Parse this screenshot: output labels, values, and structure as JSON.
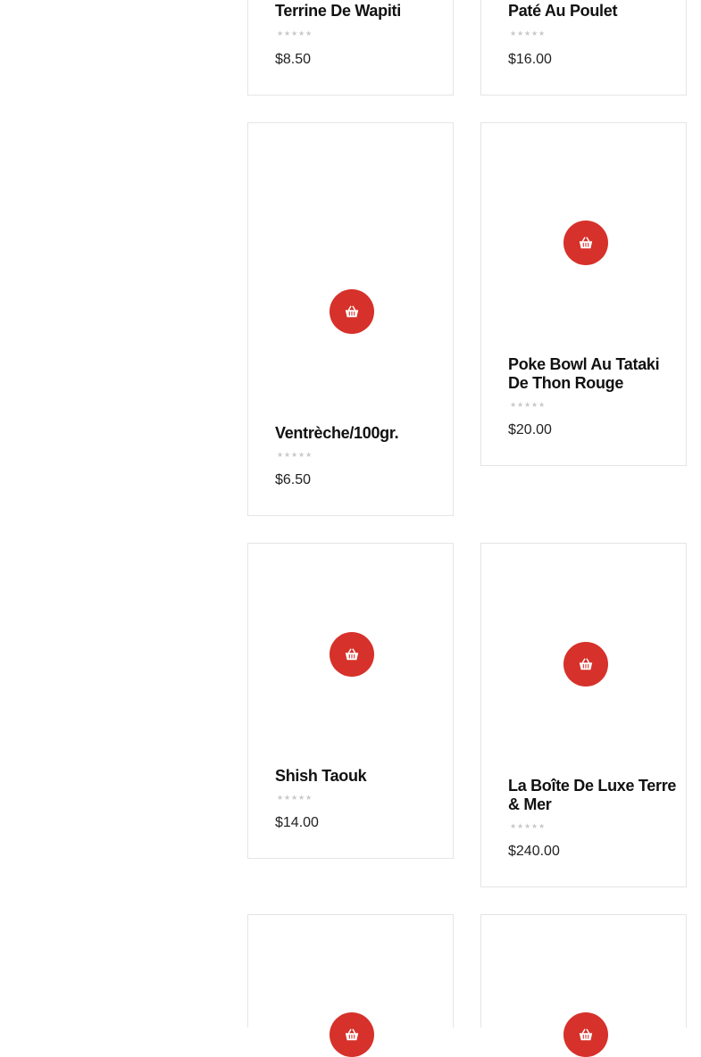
{
  "brand_color": "#d6312a",
  "star_glyph": "★",
  "icons": {
    "cart": "basket-icon",
    "rating": "star-icon"
  },
  "products": [
    {
      "name": "Terrine De Wapiti",
      "price": "$8.50",
      "rating": 0
    },
    {
      "name": "Paté Au Poulet",
      "price": "$16.00",
      "rating": 0
    },
    {
      "name": "Ventrèche/100gr.",
      "price": "$6.50",
      "rating": 0
    },
    {
      "name": "Poke Bowl Au Tataki De Thon Rouge",
      "price": "$20.00",
      "rating": 0
    },
    {
      "name": "Shish Taouk",
      "price": "$14.00",
      "rating": 0
    },
    {
      "name": "La Boîte De Luxe Terre & Mer",
      "price": "$240.00",
      "rating": 0
    }
  ]
}
